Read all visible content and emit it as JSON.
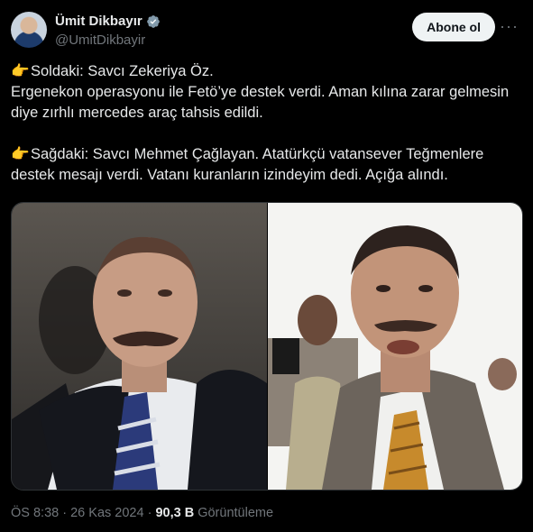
{
  "author": {
    "display_name": "Ümit Dikbayır",
    "handle": "@UmitDikbayir"
  },
  "follow_button": {
    "label": "Abone ol"
  },
  "more_label": "···",
  "tweet": {
    "emoji": "👉",
    "para1_line1": "Soldaki:  Savcı Zekeriya Öz.",
    "para1_line2": "Ergenekon operasyonu ile Fetö’ye destek verdi. Aman kılına zarar gelmesin diye zırhlı mercedes araç tahsis edildi.",
    "para2": "Sağdaki:  Savcı Mehmet Çağlayan. Atatürkçü vatansever Teğmenlere destek mesajı verdi. Vatanı kuranların izindeyim dedi. Açığa alındı."
  },
  "footer": {
    "time": "ÖS 8:38",
    "separator": "·",
    "date": "26 Kas 2024",
    "views_count": "90,3 B",
    "views_label": "Görüntüleme"
  },
  "colors": {
    "background": "#000000",
    "text": "#e7e9ea",
    "secondary_text": "#71767b",
    "verified_badge": "#829aab",
    "button_bg": "#eff3f4"
  }
}
